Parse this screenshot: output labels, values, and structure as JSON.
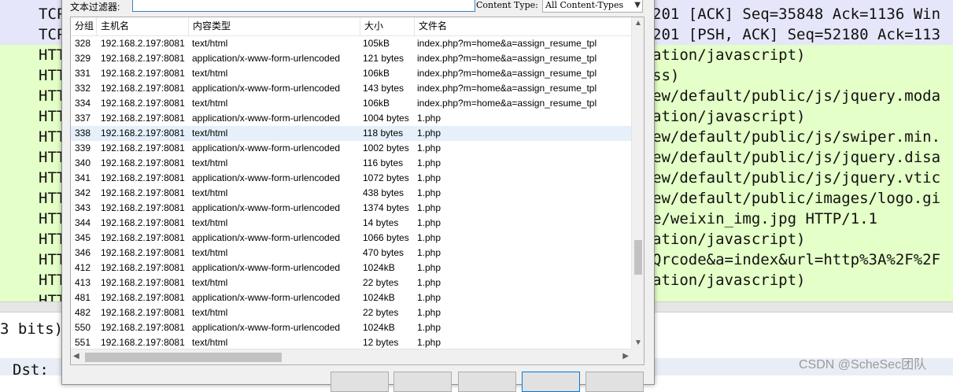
{
  "background": {
    "rows": [
      {
        "proto": "TCP",
        "info": "201 [ACK] Seq=35848 Ack=1136 Win",
        "bg": "#e6e6fa"
      },
      {
        "proto": "TCP",
        "info": "201 [PSH, ACK] Seq=52180 Ack=113",
        "bg": "#e6e6fa"
      },
      {
        "proto": "HTT",
        "info": "ation/javascript)",
        "bg": "#e4ffc7"
      },
      {
        "proto": "HTT",
        "info": "ss)",
        "bg": "#e4ffc7"
      },
      {
        "proto": "HTT",
        "info": "ew/default/public/js/jquery.moda",
        "bg": "#e4ffc7"
      },
      {
        "proto": "HTT",
        "info": "ation/javascript)",
        "bg": "#e4ffc7"
      },
      {
        "proto": "HTT",
        "info": "ew/default/public/js/swiper.min.",
        "bg": "#e4ffc7"
      },
      {
        "proto": "HTT",
        "info": "ew/default/public/js/jquery.disa",
        "bg": "#e4ffc7"
      },
      {
        "proto": "HTT",
        "info": "ew/default/public/js/jquery.vtic",
        "bg": "#e4ffc7"
      },
      {
        "proto": "HTT",
        "info": "ew/default/public/images/logo.gi",
        "bg": "#e4ffc7"
      },
      {
        "proto": "HTT",
        "info": "e/weixin_img.jpg HTTP/1.1",
        "bg": "#e4ffc7"
      },
      {
        "proto": "HTT",
        "info": "ation/javascript)",
        "bg": "#e4ffc7"
      },
      {
        "proto": "HTT",
        "info": "Qrcode&a=index&url=http%3A%2F%2F",
        "bg": "#e4ffc7"
      },
      {
        "proto": "HTT",
        "info": "ation/javascript)",
        "bg": "#e4ffc7"
      },
      {
        "proto": "HTT",
        "info": "",
        "bg": "#e4ffc7"
      }
    ],
    "bits_text": "3 bits)",
    "dst_text": "Dst:",
    "watermark": "CSDN @ScheSec团队"
  },
  "dialog": {
    "filter_label": "文本过滤器:",
    "filter_value": "",
    "content_type_label": "Content Type:",
    "content_type_value": "All Content-Types",
    "columns": [
      "分组",
      "主机名",
      "内容类型",
      "大小",
      "文件名"
    ],
    "rows": [
      {
        "id": "328",
        "host": "192.168.2.197:8081",
        "type": "text/html",
        "size": "105kB",
        "file": "index.php?m=home&a=assign_resume_tpl"
      },
      {
        "id": "329",
        "host": "192.168.2.197:8081",
        "type": "application/x-www-form-urlencoded",
        "size": "121 bytes",
        "file": "index.php?m=home&a=assign_resume_tpl"
      },
      {
        "id": "331",
        "host": "192.168.2.197:8081",
        "type": "text/html",
        "size": "106kB",
        "file": "index.php?m=home&a=assign_resume_tpl"
      },
      {
        "id": "332",
        "host": "192.168.2.197:8081",
        "type": "application/x-www-form-urlencoded",
        "size": "143 bytes",
        "file": "index.php?m=home&a=assign_resume_tpl"
      },
      {
        "id": "334",
        "host": "192.168.2.197:8081",
        "type": "text/html",
        "size": "106kB",
        "file": "index.php?m=home&a=assign_resume_tpl"
      },
      {
        "id": "337",
        "host": "192.168.2.197:8081",
        "type": "application/x-www-form-urlencoded",
        "size": "1004 bytes",
        "file": "1.php"
      },
      {
        "id": "338",
        "host": "192.168.2.197:8081",
        "type": "text/html",
        "size": "118 bytes",
        "file": "1.php",
        "selected": true
      },
      {
        "id": "339",
        "host": "192.168.2.197:8081",
        "type": "application/x-www-form-urlencoded",
        "size": "1002 bytes",
        "file": "1.php"
      },
      {
        "id": "340",
        "host": "192.168.2.197:8081",
        "type": "text/html",
        "size": "116 bytes",
        "file": "1.php"
      },
      {
        "id": "341",
        "host": "192.168.2.197:8081",
        "type": "application/x-www-form-urlencoded",
        "size": "1072 bytes",
        "file": "1.php"
      },
      {
        "id": "342",
        "host": "192.168.2.197:8081",
        "type": "text/html",
        "size": "438 bytes",
        "file": "1.php"
      },
      {
        "id": "343",
        "host": "192.168.2.197:8081",
        "type": "application/x-www-form-urlencoded",
        "size": "1374 bytes",
        "file": "1.php"
      },
      {
        "id": "344",
        "host": "192.168.2.197:8081",
        "type": "text/html",
        "size": "14 bytes",
        "file": "1.php"
      },
      {
        "id": "345",
        "host": "192.168.2.197:8081",
        "type": "application/x-www-form-urlencoded",
        "size": "1066 bytes",
        "file": "1.php"
      },
      {
        "id": "346",
        "host": "192.168.2.197:8081",
        "type": "text/html",
        "size": "470 bytes",
        "file": "1.php"
      },
      {
        "id": "412",
        "host": "192.168.2.197:8081",
        "type": "application/x-www-form-urlencoded",
        "size": "1024kB",
        "file": "1.php"
      },
      {
        "id": "413",
        "host": "192.168.2.197:8081",
        "type": "text/html",
        "size": "22 bytes",
        "file": "1.php"
      },
      {
        "id": "481",
        "host": "192.168.2.197:8081",
        "type": "application/x-www-form-urlencoded",
        "size": "1024kB",
        "file": "1.php"
      },
      {
        "id": "482",
        "host": "192.168.2.197:8081",
        "type": "text/html",
        "size": "22 bytes",
        "file": "1.php"
      },
      {
        "id": "550",
        "host": "192.168.2.197:8081",
        "type": "application/x-www-form-urlencoded",
        "size": "1024kB",
        "file": "1.php"
      },
      {
        "id": "551",
        "host": "192.168.2.197:8081",
        "type": "text/html",
        "size": "12 bytes",
        "file": "1.php"
      }
    ],
    "icons": {
      "scroll_up": "chevron-up-icon",
      "scroll_down": "chevron-down-icon",
      "scroll_left": "chevron-left-icon",
      "scroll_right": "chevron-right-icon",
      "dropdown": "chevron-down-icon"
    },
    "colors": {
      "selected_row": "#e5f0fb",
      "tcp_row": "#e6e6fa",
      "http_row": "#e4ffc7"
    }
  }
}
